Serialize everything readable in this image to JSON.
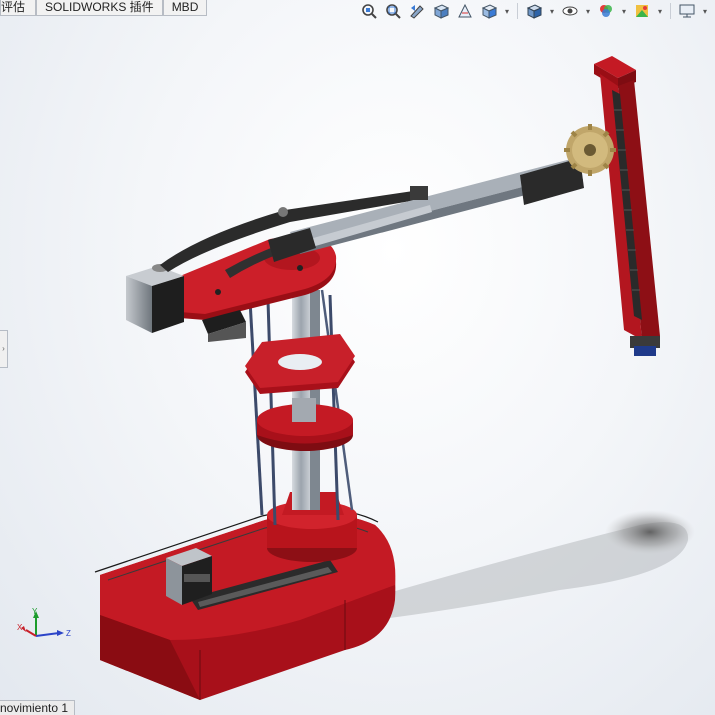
{
  "tabs": [
    {
      "label": "评估"
    },
    {
      "label": "SOLIDWORKS 插件"
    },
    {
      "label": "MBD"
    }
  ],
  "toolbar": {
    "icons": [
      "zoom-to-fit-icon",
      "zoom-to-area-icon",
      "previous-view-icon",
      "section-view-icon",
      "dynamic-annotation-icon",
      "view-orientation-icon",
      "display-style-icon",
      "hide-show-items-icon",
      "edit-appearance-icon",
      "apply-scene-icon",
      "view-settings-icon"
    ]
  },
  "triad": {
    "x_label": "X",
    "y_label": "Y",
    "z_label": "Z"
  },
  "bottom_tab": {
    "label": "novimiento 1"
  },
  "colors": {
    "model_red": "#b8141c",
    "dark_red": "#7a0b10",
    "belt": "#2b2b2b",
    "rail": "#9aa3ad",
    "motor_grey": "#8f969e"
  }
}
